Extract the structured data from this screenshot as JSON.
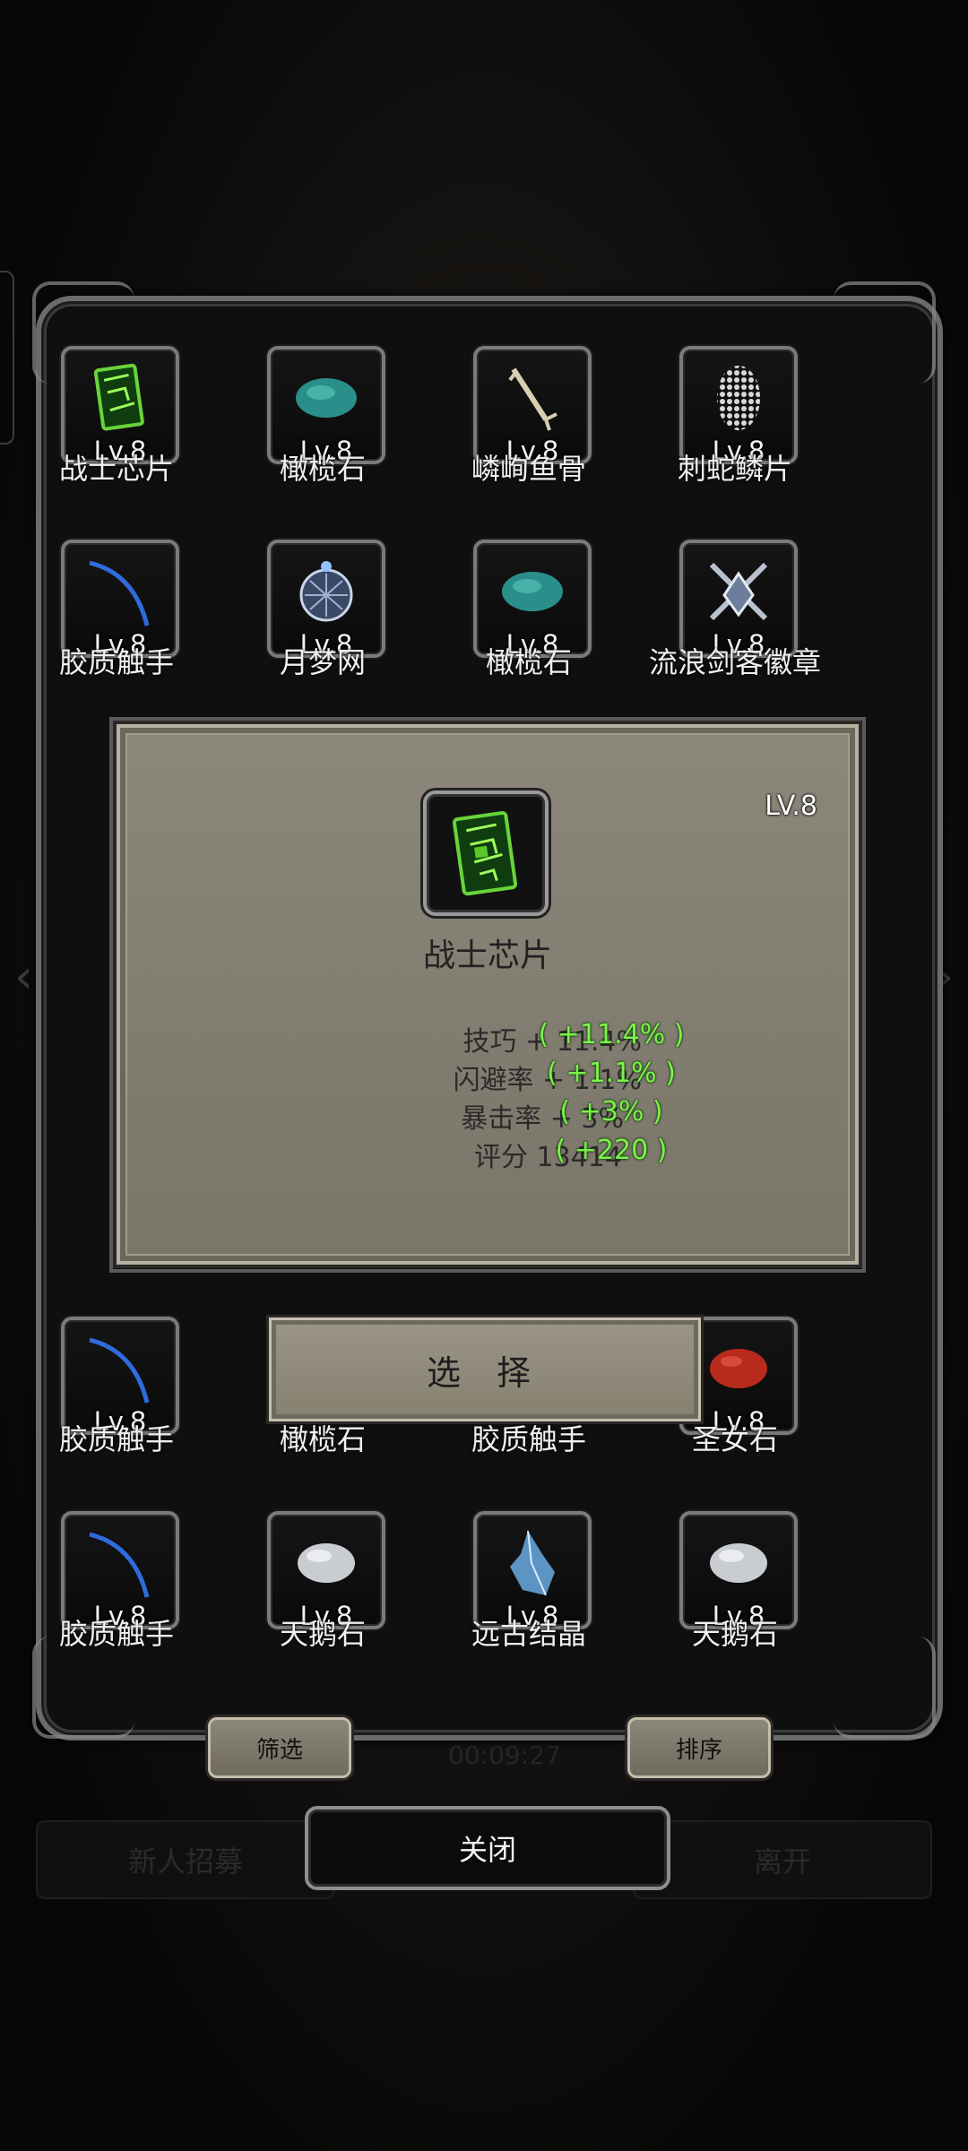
{
  "background": {
    "left_button": "新人招募",
    "right_button": "离开",
    "timer": "00:09:27"
  },
  "grid_top": [
    {
      "name": "战士芯片",
      "level": "Lv.8",
      "icon": "green-chip-icon"
    },
    {
      "name": "橄榄石",
      "level": "Lv.8",
      "icon": "teal-stone-icon"
    },
    {
      "name": "嶙峋鱼骨",
      "level": "Lv.8",
      "icon": "fish-bone-icon"
    },
    {
      "name": "刺蛇鳞片",
      "level": "Lv.8",
      "icon": "scale-icon"
    },
    {
      "name": "胶质触手",
      "level": "Lv.8",
      "icon": "tentacle-icon"
    },
    {
      "name": "月梦网",
      "level": "Lv.8",
      "icon": "dream-net-icon"
    },
    {
      "name": "橄榄石",
      "level": "Lv.8",
      "icon": "teal-stone-icon"
    },
    {
      "name": "流浪剑客徽章",
      "level": "Lv.8",
      "icon": "sword-badge-icon"
    }
  ],
  "grid_bottom": [
    {
      "name": "胶质触手",
      "level": "Lv.8",
      "icon": "tentacle-icon"
    },
    {
      "name": "橄榄石",
      "level": "",
      "icon": ""
    },
    {
      "name": "胶质触手",
      "level": "",
      "icon": ""
    },
    {
      "name": "圣女石",
      "level": "Lv.8",
      "icon": "red-stone-icon"
    },
    {
      "name": "胶质触手",
      "level": "Lv.8",
      "icon": "tentacle-icon"
    },
    {
      "name": "天鹅石",
      "level": "Lv.8",
      "icon": "white-stone-icon"
    },
    {
      "name": "远古结晶",
      "level": "Lv.8",
      "icon": "crystal-icon"
    },
    {
      "name": "天鹅石",
      "level": "Lv.8",
      "icon": "white-stone-icon"
    }
  ],
  "tooltip": {
    "level": "LV.8",
    "name": "战士芯片",
    "icon": "green-chip-icon",
    "stats": [
      {
        "text": "技巧 + 11.4%",
        "bonus": "( +11.4% )"
      },
      {
        "text": "闪避率 + 1.1%",
        "bonus": "( +1.1% )"
      },
      {
        "text": "暴击率 + 3%",
        "bonus": "( +3% )"
      },
      {
        "text": "评分 13414",
        "bonus": "( +220 )"
      }
    ],
    "bonus_color": "#7cf24a"
  },
  "buttons": {
    "select": "选 择",
    "filter": "筛选",
    "sort": "排序",
    "close": "关闭"
  }
}
